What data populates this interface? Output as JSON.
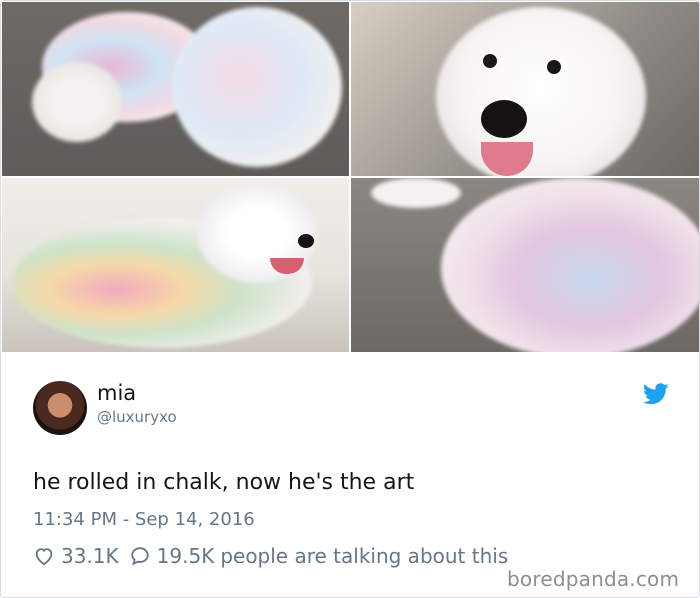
{
  "tweet": {
    "name": "mia",
    "handle": "@luxuryxo",
    "text": "he rolled in chalk, now he's the art",
    "timestamp": "11:34 PM - Sep 14, 2016",
    "likes": "33.1K",
    "replies": "19.5K",
    "talking_label": "people are talking about this"
  },
  "icons": {
    "brand": "twitter-bird-icon",
    "like": "heart-icon",
    "reply": "speech-bubble-icon"
  },
  "watermark": "boredpanda.com",
  "colors": {
    "twitter_blue": "#1da1f2",
    "text": "#14171a",
    "secondary": "#657786"
  }
}
